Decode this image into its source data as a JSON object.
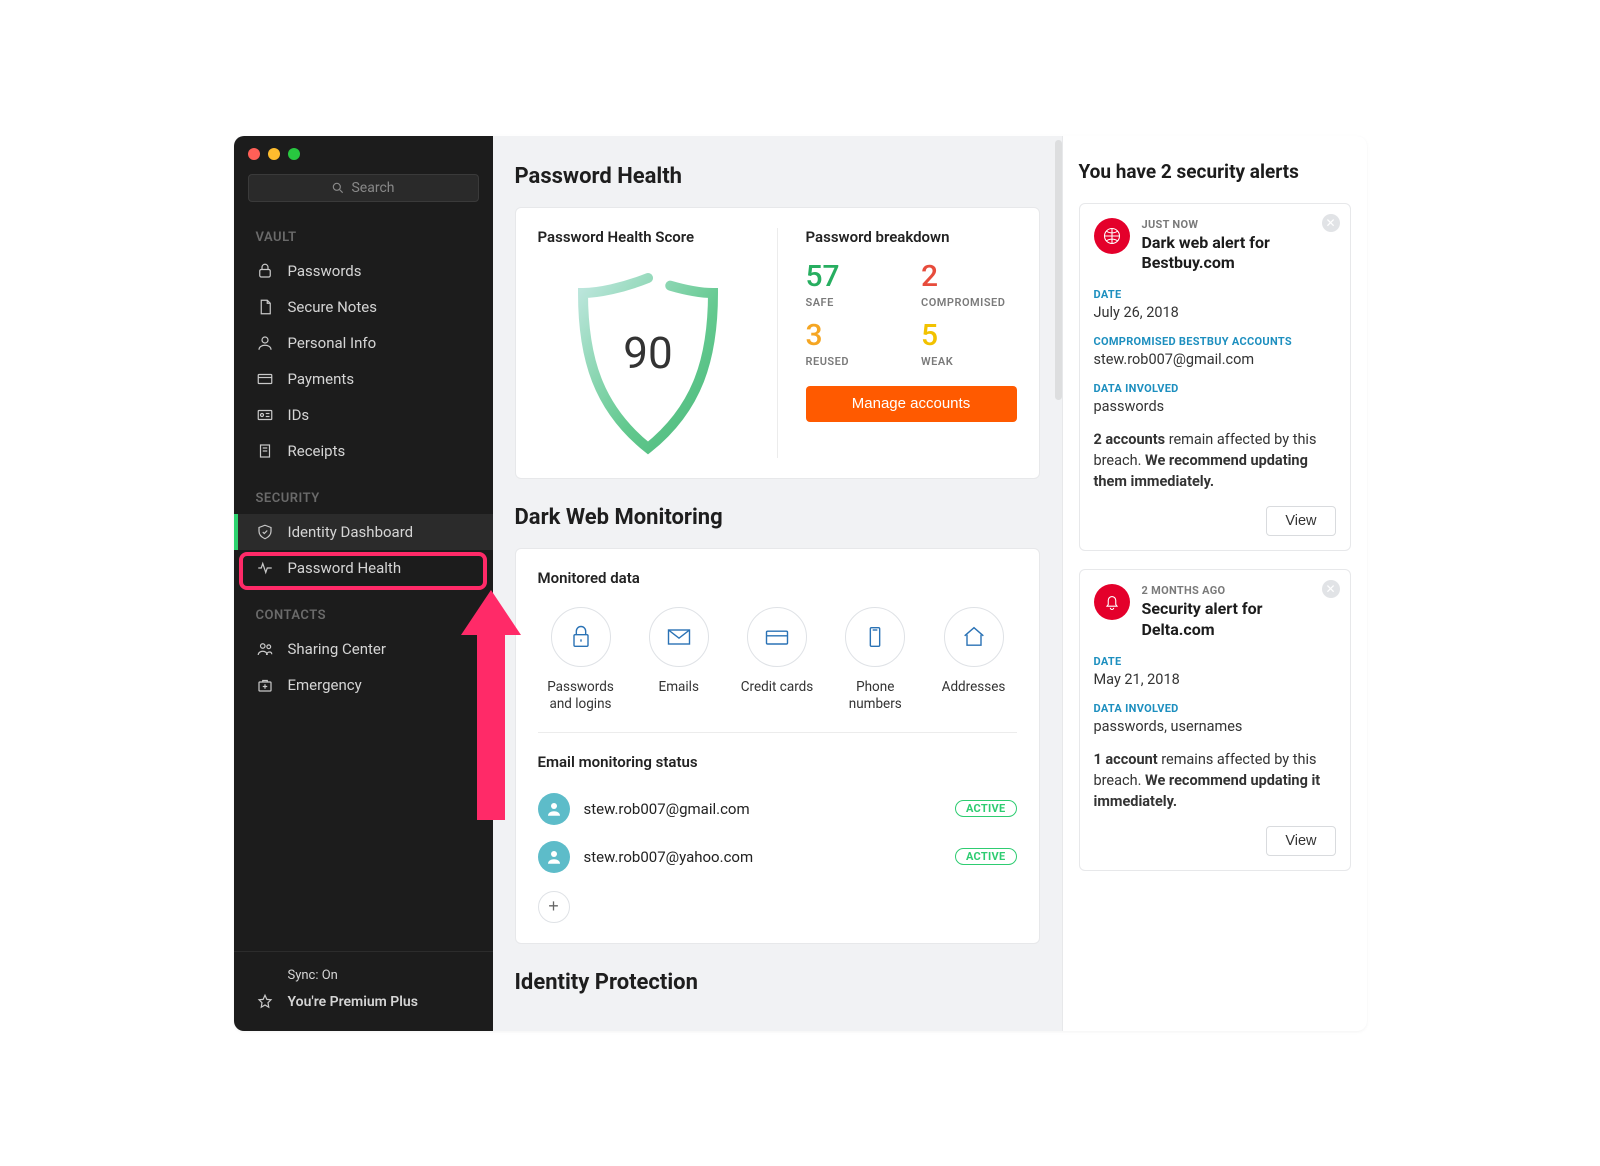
{
  "search": {
    "placeholder": "Search"
  },
  "sidebar": {
    "sections": {
      "vault": {
        "label": "VAULT",
        "items": [
          {
            "label": "Passwords"
          },
          {
            "label": "Secure Notes"
          },
          {
            "label": "Personal Info"
          },
          {
            "label": "Payments"
          },
          {
            "label": "IDs"
          },
          {
            "label": "Receipts"
          }
        ]
      },
      "security": {
        "label": "SECURITY",
        "items": [
          {
            "label": "Identity Dashboard"
          },
          {
            "label": "Password Health"
          }
        ]
      },
      "contacts": {
        "label": "CONTACTS",
        "items": [
          {
            "label": "Sharing Center"
          },
          {
            "label": "Emergency"
          }
        ]
      }
    },
    "footer": {
      "sync_label": "Sync: On",
      "plan_label": "You're Premium Plus"
    }
  },
  "main": {
    "ph_heading": "Password Health",
    "ph_score_label": "Password Health Score",
    "ph_score": "90",
    "ph_breakdown_label": "Password breakdown",
    "stats": {
      "safe": {
        "num": "57",
        "label": "SAFE"
      },
      "compromised": {
        "num": "2",
        "label": "COMPROMISED"
      },
      "reused": {
        "num": "3",
        "label": "REUSED"
      },
      "weak": {
        "num": "5",
        "label": "WEAK"
      }
    },
    "manage_btn": "Manage accounts",
    "dark_heading": "Dark Web Monitoring",
    "monitored_label": "Monitored data",
    "monitored": [
      {
        "label": "Passwords and logins"
      },
      {
        "label": "Emails"
      },
      {
        "label": "Credit cards"
      },
      {
        "label": "Phone numbers"
      },
      {
        "label": "Addresses"
      }
    ],
    "emailmon_label": "Email monitoring status",
    "emails": [
      {
        "address": "stew.rob007@gmail.com",
        "status": "ACTIVE"
      },
      {
        "address": "stew.rob007@yahoo.com",
        "status": "ACTIVE"
      }
    ],
    "truncated_section": "Identity Protection"
  },
  "right": {
    "heading": "You have 2 security alerts",
    "alerts": [
      {
        "time": "JUST NOW",
        "title": "Dark web alert for Bestbuy.com",
        "date_label": "DATE",
        "date": "July 26, 2018",
        "accounts_label": "COMPROMISED BESTBUY ACCOUNTS",
        "accounts": "stew.rob007@gmail.com",
        "data_label": "DATA INVOLVED",
        "data": "passwords",
        "body_lead": "2 accounts",
        "body_mid": " remain affected by this breach. ",
        "body_tail": "We recommend updating them immediately.",
        "view": "View"
      },
      {
        "time": "2 MONTHS AGO",
        "title": "Security alert for Delta.com",
        "date_label": "DATE",
        "date": "May 21, 2018",
        "data_label": "DATA INVOLVED",
        "data": "passwords, usernames",
        "body_lead": "1 account",
        "body_mid": " remains affected by this breach. ",
        "body_tail": "We recommend updating it immediately.",
        "view": "View"
      }
    ]
  }
}
